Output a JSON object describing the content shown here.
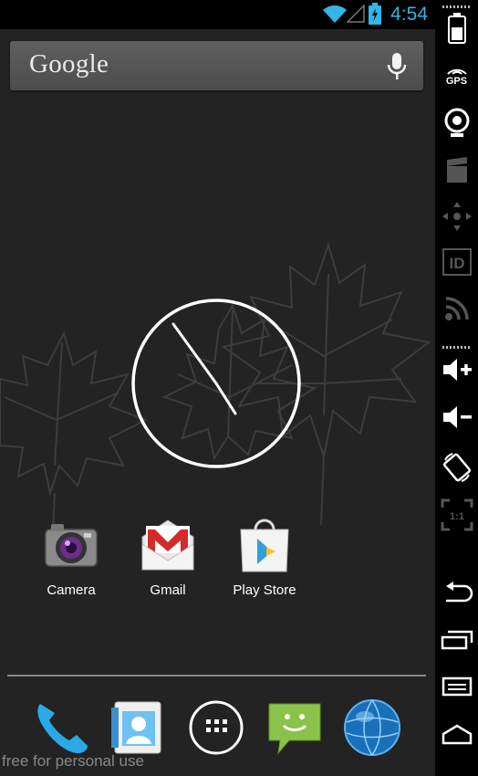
{
  "status_bar": {
    "time": "4:54",
    "icons": [
      "wifi-icon",
      "signal-icon",
      "battery-charging-icon"
    ],
    "accent_color": "#33b5e5"
  },
  "search": {
    "logo_text": "Google",
    "icons": [
      "mic-icon"
    ]
  },
  "clock_widget": {
    "type": "analog-clock",
    "hour": 4,
    "minute": 54
  },
  "apps": [
    {
      "label": "Camera",
      "icon": "camera-icon"
    },
    {
      "label": "Gmail",
      "icon": "gmail-icon"
    },
    {
      "label": "Play Store",
      "icon": "play-store-icon"
    }
  ],
  "dock": [
    {
      "icon": "phone-icon"
    },
    {
      "icon": "contacts-icon"
    },
    {
      "icon": "all-apps-icon"
    },
    {
      "icon": "messaging-icon"
    },
    {
      "icon": "browser-icon"
    }
  ],
  "watermark": "free for personal use",
  "side_panel": {
    "gps_label": "GPS",
    "id_label": "ID",
    "scale_label": "1:1",
    "buttons": [
      "battery-icon",
      "gps-icon",
      "webcam-icon",
      "video-icon",
      "move-icon",
      "id-icon",
      "rss-icon",
      "volume-up-icon",
      "volume-down-icon",
      "rotate-icon",
      "scale-icon",
      "back-icon",
      "recent-apps-icon",
      "menu-icon",
      "home-icon"
    ]
  }
}
